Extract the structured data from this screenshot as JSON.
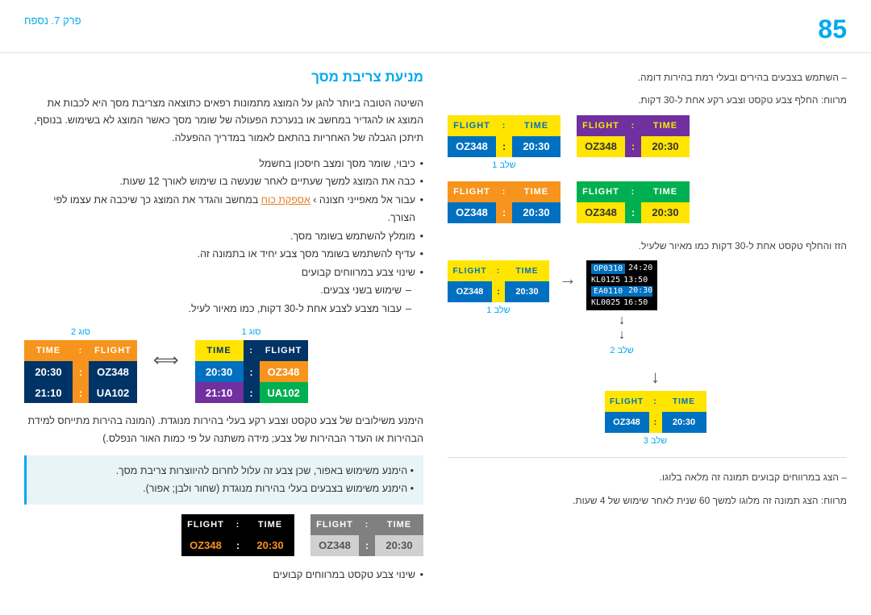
{
  "header": {
    "page_number": "85",
    "chapter": "פרק 7. נספח"
  },
  "right_col": {
    "title": "מניעת צריבת מסך",
    "intro": "השיטה הטובה ביותר להגן על המוצג מתמונות רפאים כתוצאה מצריבת מסך היא לכבות את המוצג או להגדיר במחשב או בנערכת הפעולה של שומר מסך כאשר המוצג לא בשימוש. בנוסף, תיתכן הגבלה של האחריות בהתאם לאמור במדריך ההפעלה.",
    "bullets": [
      "כיבוי, שומר מסך ומצב חיסכון בחשמל",
      "כבה את המוצג למשך שעתיים לאחר שנעשה בו שימוש לאורך 12 שעות.",
      "עבור אל מאפייני חצונה › אספקת כוח במחשב והגדר את המוצג כך שיכבה את עצמו לפי הצורך.",
      "מומלץ להשתמש בשומר מסך.",
      "עדיף להשתמש בשומר מסך צבע יחיד או בתמונה זה.",
      "שינוי צבע במרווחים קבועים",
      "שימוש בשני צבעים.",
      "עבור מצבע לצבע אחת ל-30 דקות, כמו מאיור לעיל."
    ],
    "type1_label": "סוג 1",
    "type2_label": "סוג 2",
    "bottom_text1": "הימנע משילובים של צבע טקסט וצבע רקע בעלי בהירות מנוגדת. (המונה בהירות מתייחס למידת הבהירות או העדר הבהירות של צבע; מידה משתנה על פי כמות האור הנפלס.)",
    "info_bullet1": "הימנע משימוש באפור, שכן צבע זה עלול לחרום להיווצרות צריבת מסך.",
    "info_bullet2": "הימנע משימוש בצבעים בעלי בהירות מנוגדת (שחור ולבן; אפור).",
    "bottom_bullet": "שינוי צבע טקסט במרווחים קבועים"
  },
  "left_col": {
    "hint1": "– השתמש בצבעים בהירים ובעלי רמת בהירות דומה.",
    "hint2": "מרווח: החלף צבע טקסט וצבע רקע אחת ל-30 דקות.",
    "step1_label": "שלב 1",
    "step2_label": "שלב 2",
    "step3_label": "שלב 3",
    "hint3": "הזז והחלף טקסט אחת ל-30 דקות כמו מאיור שלעיל.",
    "hint4": "– הצג במרווחים קבועים תמונה זה מלאה בלוגו.",
    "hint5": "מרווח: הצג תמונה זה מלוגו למשך 60 שנית לאחר שימוש של 4 שעות."
  },
  "flights": {
    "OZ348": "OZ348",
    "time1": "20:30",
    "UA102": "UA102",
    "time2": "21:10",
    "flight_label": "FLIGHT",
    "time_label": "TIME",
    "board_flights": [
      {
        "code": "OP0310",
        "time": "24:20"
      },
      {
        "code": "KL0125",
        "time": "13:50"
      },
      {
        "code": "EA0110",
        "time": "20:30"
      },
      {
        "code": "KL0025",
        "time": "16:50"
      }
    ]
  }
}
